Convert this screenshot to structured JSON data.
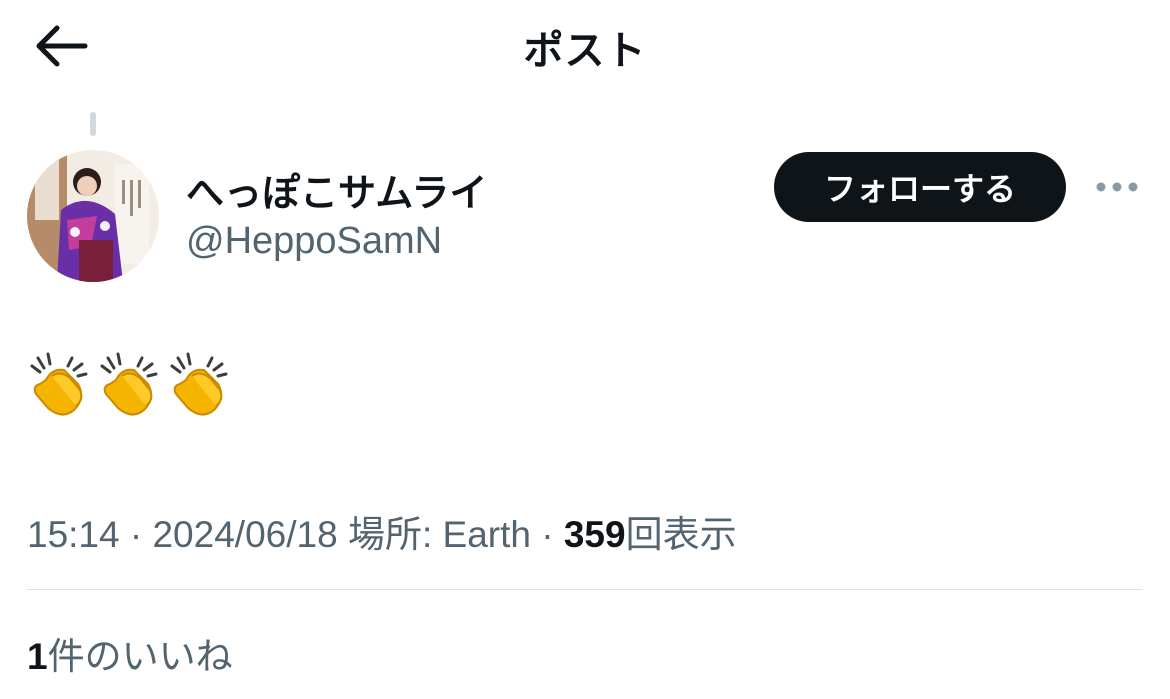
{
  "header": {
    "title": "ポスト",
    "back_icon": "arrow-left-icon"
  },
  "author": {
    "display_name": "へっぽこサムライ",
    "handle": "@HeppoSamN",
    "follow_label": "フォローする",
    "more_icon": "more-horizontal-icon"
  },
  "post": {
    "text": "👏👏👏"
  },
  "meta": {
    "time": "15:14",
    "separator": " · ",
    "date": "2024/06/18",
    "location": " 場所: Earth",
    "separator2": " · ",
    "views_count": "359",
    "views_label": "回表示"
  },
  "likes": {
    "count": "1",
    "label": "件のいいね"
  },
  "colors": {
    "primary_text": "#0f1419",
    "secondary_text": "#536471",
    "button_bg": "#0f1419",
    "divider": "#dbe1e5"
  }
}
